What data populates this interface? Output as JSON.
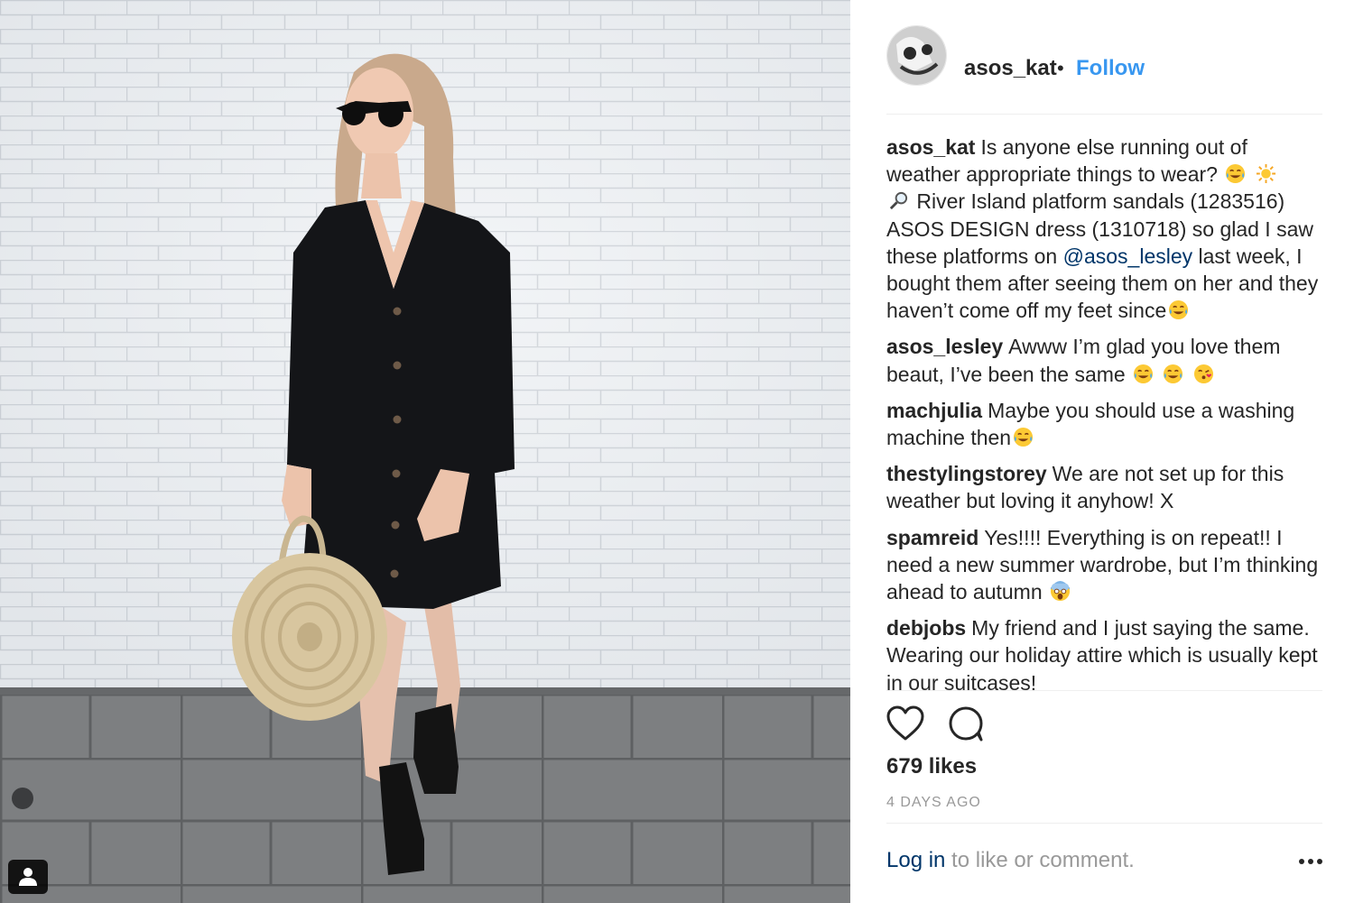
{
  "post": {
    "username": "asos_kat",
    "separator": "•",
    "follow_label": "Follow",
    "likes": "679 likes",
    "timestamp": "4 DAYS AGO"
  },
  "caption": {
    "username": "asos_kat",
    "text_1": "Is anyone else running out of weather appropriate things to wear?",
    "text_2": "River Island platform sandals (1283516) ASOS DESIGN dress (1310718) so glad I saw these platforms on",
    "mention": "@asos_lesley",
    "text_3": "last week, I bought them after seeing them on her and they haven’t come off my feet since"
  },
  "comments": [
    {
      "username": "asos_lesley",
      "text": "Awww I’m glad you love them beaut, I’ve been the same"
    },
    {
      "username": "machjulia",
      "text": "Maybe you should use a washing machine then"
    },
    {
      "username": "thestylingstorey",
      "text": "We are not set up for this weather but loving it anyhow! X"
    },
    {
      "username": "spamreid",
      "text": "Yes!!!! Everything is on repeat!! I need a new summer wardrobe, but I’m thinking ahead to autumn"
    },
    {
      "username": "debjobs",
      "text": "My friend and I just saying the same. Wearing our holiday attire which is usually kept in our suitcases!"
    }
  ],
  "footer": {
    "login_label": "Log in",
    "login_rest": " to like or comment.",
    "more_icon": "ellipsis-icon"
  },
  "colors": {
    "accent": "#3897f0",
    "link": "#003569",
    "muted": "#999999",
    "text": "#262626"
  }
}
